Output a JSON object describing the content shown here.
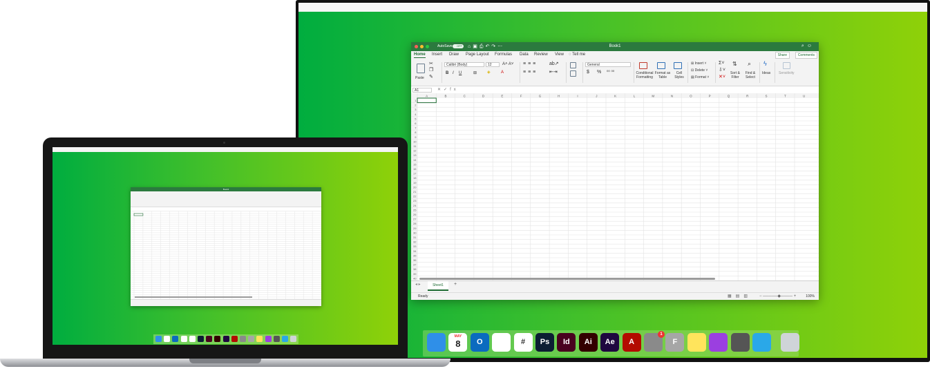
{
  "excel": {
    "autosave_label": "AutoSave",
    "autosave_state": "OFF",
    "window_title": "Book1",
    "tabs": [
      "Home",
      "Insert",
      "Draw",
      "Page Layout",
      "Formulas",
      "Data",
      "Review",
      "View",
      "Tell me"
    ],
    "share_label": "Share",
    "comments_label": "Comments",
    "ribbon": {
      "paste": "Paste",
      "font_name": "Calibri (Body)",
      "font_size": "12",
      "number_format": "General",
      "conditional_formatting": "Conditional Formatting",
      "format_as_table": "Format as Table",
      "cell_styles": "Cell Styles",
      "insert": "Insert",
      "delete": "Delete",
      "format": "Format",
      "sort_filter": "Sort & Filter",
      "find_select": "Find & Select",
      "ideas": "Ideas",
      "sensitivity": "Sensitivity",
      "bold": "B",
      "italic": "I",
      "underline": "U",
      "currency": "$",
      "percent": "%"
    },
    "name_box": "A1",
    "fx_label": "fx",
    "columns": [
      "A",
      "B",
      "C",
      "D",
      "E",
      "F",
      "G",
      "H",
      "I",
      "J",
      "K",
      "L",
      "M",
      "N",
      "O",
      "P",
      "Q",
      "R",
      "S",
      "T",
      "U"
    ],
    "row_count": 40,
    "sheet_tab": "Sheet1",
    "add_sheet": "+",
    "status": "Ready",
    "zoom": "100%"
  },
  "dock": {
    "apps": [
      {
        "name": "Finder",
        "glyph": "",
        "color": "#2f8fe8"
      },
      {
        "name": "Calendar",
        "glyph": "8",
        "color": "#ffffff"
      },
      {
        "name": "Outlook",
        "glyph": "O",
        "color": "#0b6bbf"
      },
      {
        "name": "Chrome",
        "glyph": "",
        "color": "#ffffff"
      },
      {
        "name": "Slack",
        "glyph": "#",
        "color": "#ffffff"
      },
      {
        "name": "Photoshop",
        "glyph": "Ps",
        "color": "#0c1d33"
      },
      {
        "name": "InDesign",
        "glyph": "Id",
        "color": "#49021f"
      },
      {
        "name": "Illustrator",
        "glyph": "Ai",
        "color": "#330000"
      },
      {
        "name": "After Effects",
        "glyph": "Ae",
        "color": "#1f0740"
      },
      {
        "name": "Acrobat",
        "glyph": "A",
        "color": "#b30b00"
      },
      {
        "name": "System Preferences",
        "glyph": "",
        "color": "#8a8a8a"
      },
      {
        "name": "Font Book",
        "glyph": "F",
        "color": "#a6a6a6"
      },
      {
        "name": "Notes",
        "glyph": "",
        "color": "#ffe45c"
      },
      {
        "name": "Podcasts",
        "glyph": "",
        "color": "#9b3fe0"
      },
      {
        "name": "Calculator",
        "glyph": "",
        "color": "#555555"
      },
      {
        "name": "Screen Recorder",
        "glyph": "",
        "color": "#2aa8e8"
      },
      {
        "name": "Trash",
        "glyph": "",
        "color": "#cfd4d8"
      }
    ],
    "calendar_month": "MAY",
    "calendar_day": "8",
    "sysprefs_badge": "1"
  }
}
